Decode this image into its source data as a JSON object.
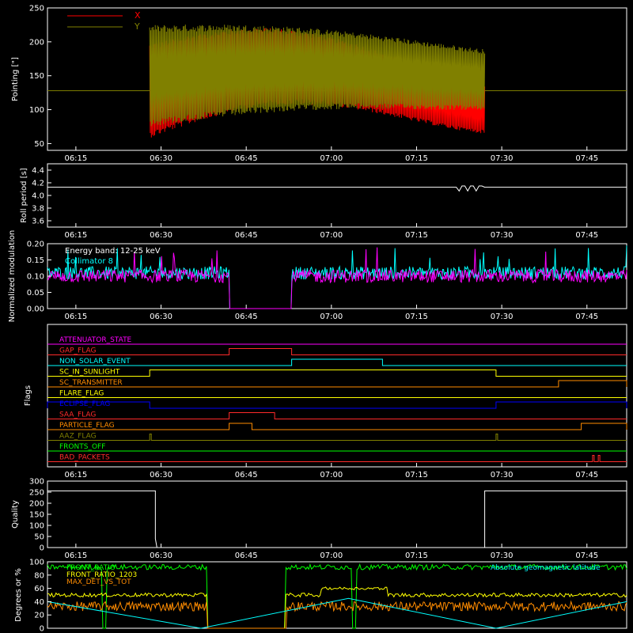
{
  "colors": {
    "background": "#000000",
    "axes": "#ffffff",
    "x_pointing": "#ff0000",
    "y_pointing": "#808000",
    "magenta": "#ff00ff",
    "cyan": "#00ffff",
    "green": "#00ff00",
    "yellow": "#ffff00",
    "orange": "#ff8c00",
    "blue": "#0000ff",
    "red": "#ff2a2a"
  },
  "time_ticks": [
    "06:15",
    "06:30",
    "06:45",
    "07:00",
    "07:15",
    "07:30",
    "07:45"
  ],
  "chart_data": [
    {
      "id": "pointing",
      "type": "line",
      "ylabel": "Pointing [\"]",
      "ylim": [
        40,
        250
      ],
      "yticks": [
        50,
        100,
        150,
        200,
        250
      ],
      "legend": [
        "X",
        "Y"
      ],
      "x_range": [
        "06:10",
        "07:52"
      ],
      "series": [
        {
          "name": "X",
          "color": "#ff0000",
          "note_active": [
            "06:28",
            "07:27"
          ],
          "center": 128,
          "amplitude_start": 70,
          "amplitude_end": 35
        },
        {
          "name": "Y",
          "color": "#808000",
          "note_active": [
            "06:28",
            "07:27"
          ],
          "center": 155,
          "amplitude_start": 75,
          "amplitude_end": 45
        }
      ],
      "baseline": 128
    },
    {
      "id": "roll-period",
      "type": "line",
      "ylabel": "Roll period [s]",
      "ylim": [
        3.5,
        4.5
      ],
      "yticks": [
        "3.6",
        "3.8",
        "4.0",
        "4.2",
        "4.4"
      ],
      "series": [
        {
          "name": "",
          "color": "#ffffff",
          "level": 4.13
        }
      ]
    },
    {
      "id": "modulation",
      "type": "bar",
      "ylabel": "Normalized modulation",
      "ylim": [
        0.0,
        0.2
      ],
      "yticks": [
        "0.00",
        "0.05",
        "0.10",
        "0.15",
        "0.20"
      ],
      "legend": [
        "Energy band: 12-25 keV",
        "Collimator 8"
      ],
      "gap": [
        "06:42",
        "06:53"
      ],
      "series": [
        {
          "name": "Energy band: 12-25 keV",
          "color": "#ff00ff",
          "level": 0.1
        },
        {
          "name": "Collimator 8",
          "color": "#00ffff",
          "level": 0.11
        }
      ]
    },
    {
      "id": "flags",
      "type": "line",
      "ylabel": "Flags",
      "flags": [
        {
          "name": "ATTENUATOR_STATE",
          "color": "#ff00ff",
          "segments": []
        },
        {
          "name": "GAP_FLAG",
          "color": "#ff2a2a",
          "segments": [
            [
              "06:42",
              "06:53"
            ]
          ]
        },
        {
          "name": "NON_SOLAR_EVENT",
          "color": "#00ffff",
          "segments": [
            [
              "06:53",
              "07:09"
            ]
          ]
        },
        {
          "name": "SC_IN_SUNLIGHT",
          "color": "#ffff00",
          "segments": [
            [
              "06:28",
              "07:29"
            ]
          ]
        },
        {
          "name": "SC_TRANSMITTER",
          "color": "#ff8c00",
          "segments": [
            [
              "07:40",
              "07:52"
            ]
          ]
        },
        {
          "name": "FLARE_FLAG",
          "color": "#ffff00",
          "segments": []
        },
        {
          "name": "ECLIPSE_FLAG",
          "color": "#0000ff",
          "segments": [
            [
              "06:10",
              "06:28"
            ],
            [
              "07:29",
              "07:52"
            ]
          ]
        },
        {
          "name": "SAA_FLAG",
          "color": "#ff2a2a",
          "segments": [
            [
              "06:42",
              "06:50"
            ]
          ]
        },
        {
          "name": "PARTICLE_FLAG",
          "color": "#ff8c00",
          "segments": [
            [
              "06:42",
              "06:46"
            ],
            [
              "07:44",
              "07:52"
            ]
          ]
        },
        {
          "name": "AAZ_FLAG",
          "color": "#808000",
          "segments": [
            [
              "06:28",
              "06:28"
            ],
            [
              "07:29",
              "07:29"
            ]
          ]
        },
        {
          "name": "FRONTS_OFF",
          "color": "#00ff00",
          "segments": []
        },
        {
          "name": "BAD_PACKETS",
          "color": "#ff2a2a",
          "segments": [
            [
              "07:46",
              "07:46"
            ],
            [
              "07:47",
              "07:47"
            ]
          ]
        }
      ]
    },
    {
      "id": "quality",
      "type": "line",
      "ylabel": "Quality",
      "ylim": [
        0,
        300
      ],
      "yticks": [
        0,
        50,
        100,
        150,
        200,
        250,
        300
      ],
      "series": [
        {
          "name": "",
          "color": "#ffffff",
          "high_before": "06:29",
          "high_after": "07:27",
          "high_value": 256,
          "low_value": 0
        }
      ]
    },
    {
      "id": "degrees",
      "type": "line",
      "ylabel": "Degrees or %",
      "ylim": [
        0,
        100
      ],
      "yticks": [
        0,
        20,
        40,
        60,
        80,
        100
      ],
      "legend": [
        "FRONT_RATIO",
        "FRONT_RATIO_1203",
        "MAX_DET_VS_TOT",
        "Absolute geomagnetic latitude"
      ],
      "series": [
        {
          "name": "FRONT_RATIO",
          "color": "#00ff00",
          "level": 92
        },
        {
          "name": "FRONT_RATIO_1203",
          "color": "#ffff00",
          "level": 50
        },
        {
          "name": "MAX_DET_VS_TOT",
          "color": "#ff8c00",
          "level": 33
        },
        {
          "name": "Absolute geomagnetic latitude",
          "color": "#00ffff",
          "peak": 45
        }
      ]
    }
  ]
}
